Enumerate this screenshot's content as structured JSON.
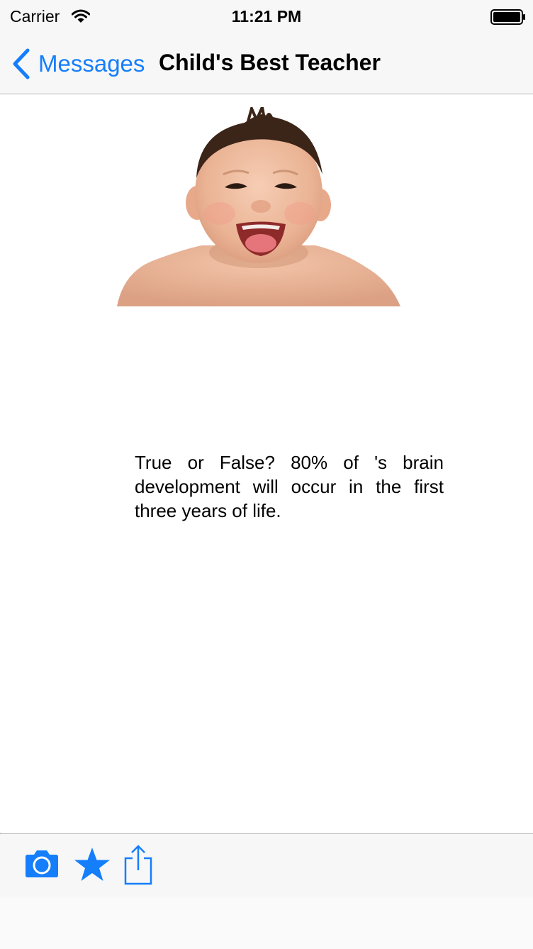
{
  "status_bar": {
    "carrier": "Carrier",
    "time": "11:21 PM",
    "icons": [
      "wifi-icon",
      "battery-icon"
    ]
  },
  "nav": {
    "back_label": "Messages",
    "title": "Child's Best Teacher"
  },
  "content": {
    "image": "smiling-baby-photo",
    "question": "True or False? 80% of 's brain development will occur in the first three years of life."
  },
  "toolbar": {
    "items": [
      {
        "icon": "camera-icon"
      },
      {
        "icon": "star-icon"
      },
      {
        "icon": "share-icon"
      }
    ]
  },
  "colors": {
    "accent": "#157efb",
    "bar_background": "#f7f7f7"
  }
}
